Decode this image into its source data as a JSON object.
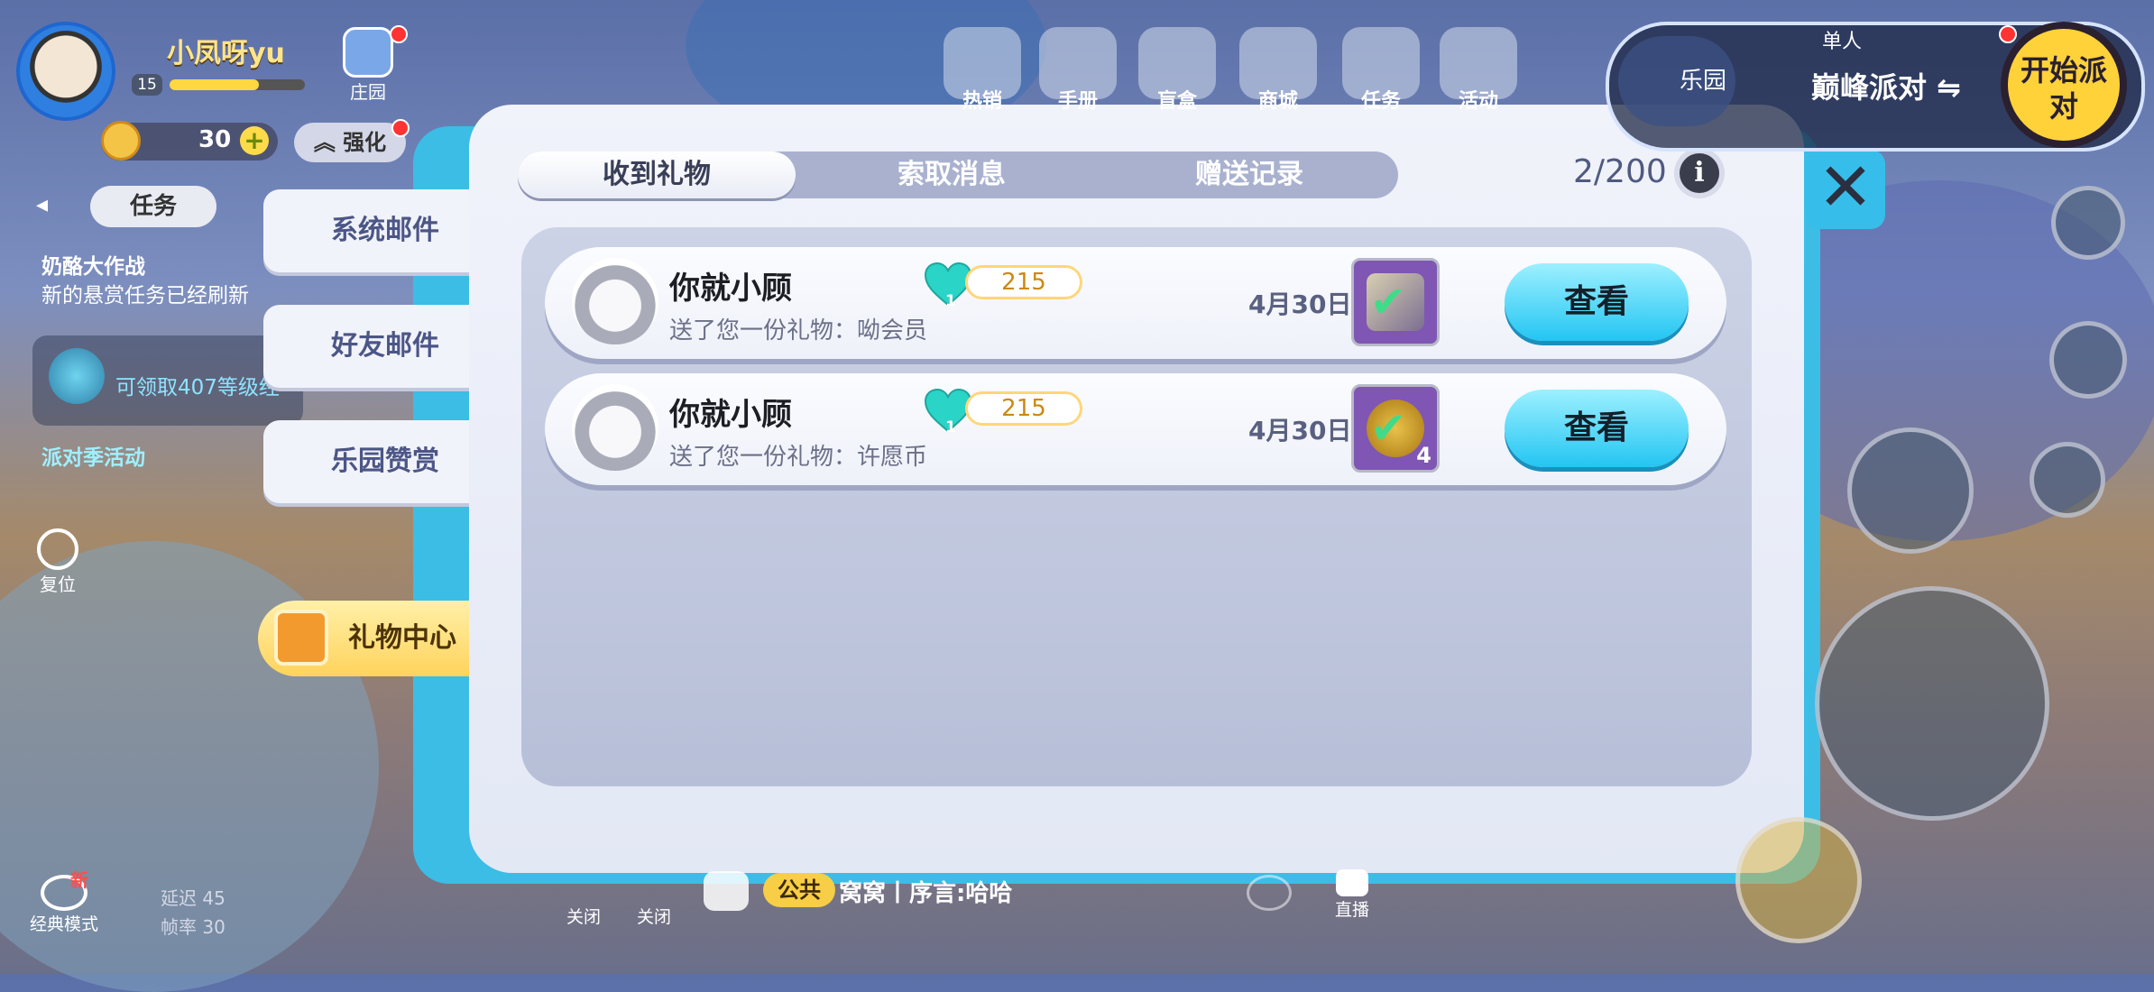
{
  "player": {
    "name": "小凤呀yu",
    "level": "15",
    "coins": "30",
    "home_label": "庄园",
    "upgrade_label": "强化"
  },
  "tasks": {
    "tab_label": "任务",
    "item1_title": "奶酪大作战",
    "item1_desc": "新的悬赏任务已经刷新",
    "potion_text": "可领取407等级经",
    "item3_title": "派对季活动",
    "reset_label": "复位"
  },
  "mail_tabs": [
    "系统邮件",
    "好友邮件",
    "乐园赞赏"
  ],
  "gift_center_label": "礼物中心",
  "modal": {
    "tabs": [
      "收到礼物",
      "索取消息",
      "赠送记录"
    ],
    "active_tab": 0,
    "count": "2/200",
    "info_icon": "i",
    "close_icon": "✕"
  },
  "gifts": [
    {
      "sender": "你就小顾",
      "desc": "送了您一份礼物：呦会员",
      "heart_num": "1",
      "heart_value": "215",
      "date": "4月30日",
      "item_qty": "",
      "button": "查看"
    },
    {
      "sender": "你就小顾",
      "desc": "送了您一份礼物：许愿币",
      "heart_num": "1",
      "heart_value": "215",
      "date": "4月30日",
      "item_qty": "4",
      "button": "查看"
    }
  ],
  "top_nav": [
    "热销",
    "手册",
    "盲盒",
    "商城",
    "任务",
    "活动"
  ],
  "party": {
    "yuan_label": "乐园",
    "mode": "单人",
    "name": "巅峰派对",
    "start_label": "开始派对"
  },
  "bottom": {
    "classic_mode": "经典模式",
    "new_badge": "新",
    "latency": "延迟 45",
    "framerate": "帧率 30",
    "mute1": "关闭",
    "mute2": "关闭",
    "channel": "公共",
    "chat_text": "窝窝丨序言:哈哈",
    "live": "直播"
  },
  "colors": {
    "accent": "#3bbde6",
    "button": "#23c5f2",
    "gift_center": "#ffd35c",
    "heart": "#2ad4c6"
  }
}
